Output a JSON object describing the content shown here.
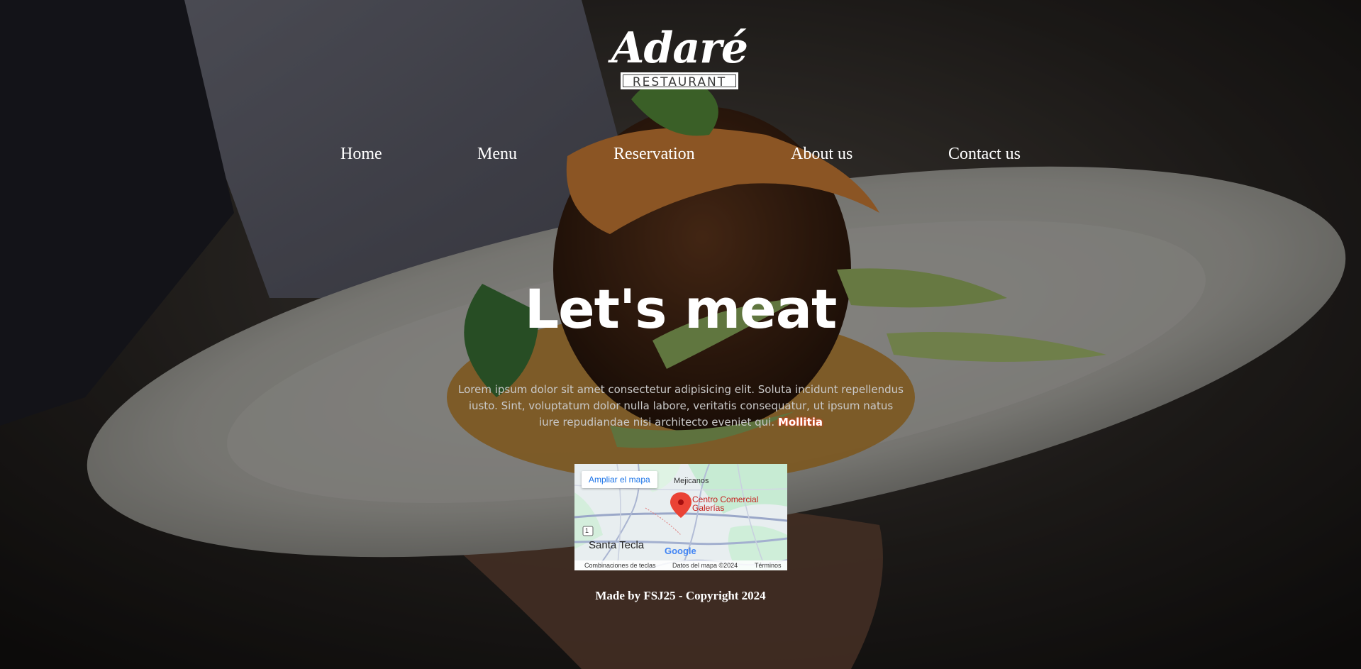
{
  "logo": {
    "wordmark": "Adaré",
    "subtitle": "RESTAURANT"
  },
  "nav": {
    "items": [
      {
        "label": "Home"
      },
      {
        "label": "Menu"
      },
      {
        "label": "Reservation"
      },
      {
        "label": "About us"
      },
      {
        "label": "Contact us"
      }
    ]
  },
  "hero": {
    "title": "Let's meat",
    "body": "Lorem ipsum dolor sit amet consectetur adipisicing elit. Soluta incidunt repellendus iusto. Sint, voluptatum dolor nulla labore, veritatis consequatur, ut ipsum natus iure repudiandae nisi architecto eveniet qui.",
    "emphasis": "Mollitia"
  },
  "map": {
    "enlarge_label": "Ampliar el mapa",
    "place_label_line1": "Centro Comercial",
    "place_label_line2": "Galerías",
    "area_label": "Mejicanos",
    "city_label": "Santa Tecla",
    "route_number": "1",
    "brand": "Google",
    "footer_shortcuts": "Combinaciones de teclas",
    "footer_data": "Datos del mapa ©2024",
    "footer_terms": "Términos"
  },
  "footer": {
    "text": "Made by FSJ25 - Copyright 2024"
  },
  "colors": {
    "text": "#ffffff",
    "body_text": "#c9c9c9",
    "map_link": "#1a73e8",
    "map_pin": "#ea4335",
    "place_label": "#c5221f"
  }
}
